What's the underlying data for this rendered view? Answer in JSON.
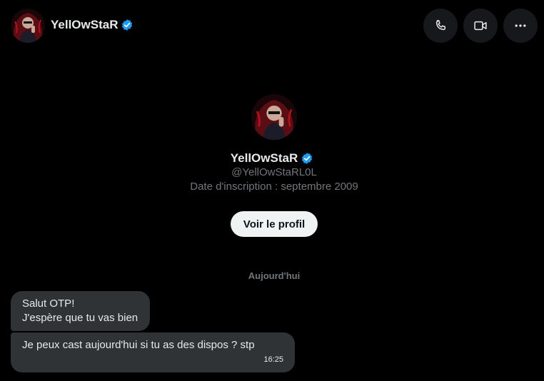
{
  "header": {
    "display_name": "YellOwStaR",
    "verified_icon": "verified-badge-icon",
    "actions": [
      {
        "name": "call",
        "icon": "phone-icon"
      },
      {
        "name": "video",
        "icon": "video-camera-icon"
      },
      {
        "name": "more",
        "icon": "more-horizontal-icon"
      }
    ]
  },
  "profile": {
    "display_name": "YellOwStaR",
    "handle": "@YellOwStaRL0L",
    "joined": "Date d'inscription : septembre 2009",
    "view_profile_label": "Voir le profil"
  },
  "conversation": {
    "date_separator": "Aujourd'hui",
    "messages": [
      {
        "lines": [
          "Salut OTP!",
          "J'espère que tu vas bien"
        ]
      },
      {
        "lines": [
          "Je peux cast aujourd'hui si tu as des dispos ? stp"
        ],
        "time": "16:25"
      }
    ]
  },
  "colors": {
    "background": "#000000",
    "bubble": "#2f3336",
    "verified": "#1d9bf0",
    "secondary_text": "#71767b",
    "button_bg": "#eff3f4"
  }
}
